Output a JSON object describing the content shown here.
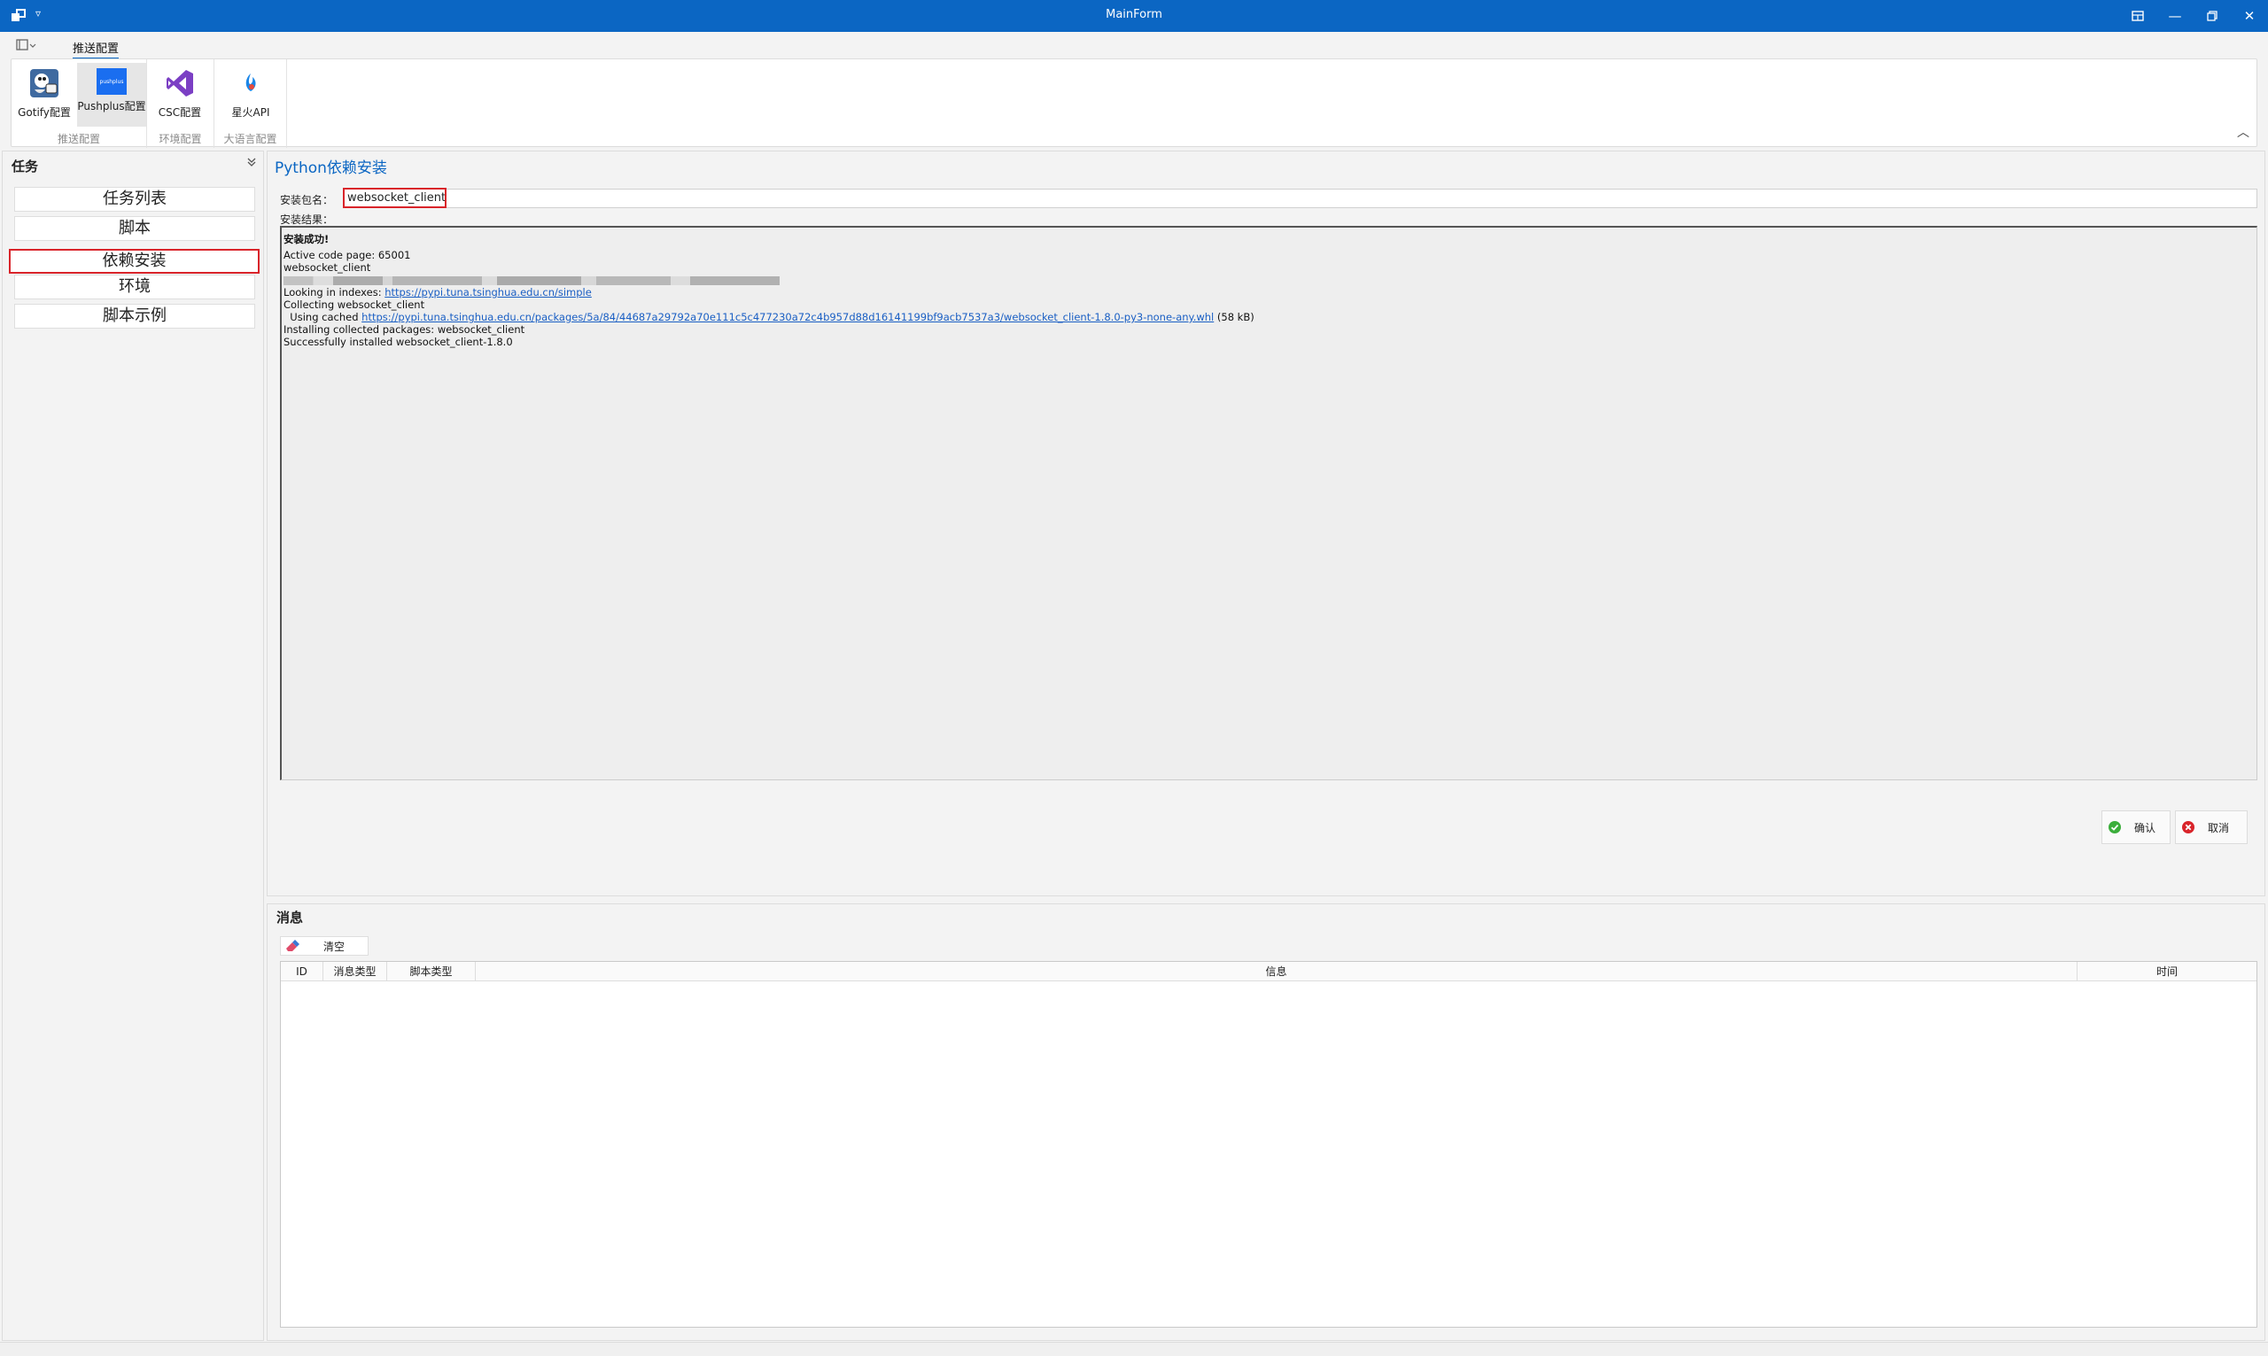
{
  "window": {
    "title": "MainForm"
  },
  "ribbon": {
    "active_tab": "推送配置",
    "groups": [
      {
        "label": "推送配置",
        "buttons": [
          {
            "label": "Gotify配置"
          },
          {
            "label": "Pushplus配置",
            "icon_text": "pushplus"
          }
        ]
      },
      {
        "label": "环境配置",
        "buttons": [
          {
            "label": "CSC配置"
          }
        ]
      },
      {
        "label": "大语言配置",
        "buttons": [
          {
            "label": "星火API"
          }
        ]
      }
    ]
  },
  "left_panel": {
    "title": "任务",
    "items": [
      "任务列表",
      "脚本",
      "依赖安装",
      "环境",
      "脚本示例"
    ],
    "selected_index": 2
  },
  "install": {
    "title": "Python依赖安装",
    "package_label": "安装包名：",
    "package_value": "websocket_client",
    "result_label": "安装结果：",
    "result_lines": {
      "l0": "安装成功!",
      "l1": "Active code page: 65001",
      "l2": "websocket_client",
      "l4_prefix": "Looking in indexes: ",
      "l4_link": "https://pypi.tuna.tsinghua.edu.cn/simple",
      "l5": "Collecting websocket_client",
      "l6_prefix": "  Using cached ",
      "l6_link": "https://pypi.tuna.tsinghua.edu.cn/packages/5a/84/44687a29792a70e111c5c477230a72c4b957d88d16141199bf9acb7537a3/websocket_client-1.8.0-py3-none-any.whl",
      "l6_suffix": " (58 kB)",
      "l7": "Installing collected packages: websocket_client",
      "l8": "Successfully installed websocket_client-1.8.0"
    },
    "confirm_label": "确认",
    "cancel_label": "取消"
  },
  "messages": {
    "title": "消息",
    "clear_label": "清空",
    "columns": [
      "ID",
      "消息类型",
      "脚本类型",
      "信息",
      "时间"
    ]
  },
  "colors": {
    "accent": "#0b66c3",
    "highlight": "#d9242a"
  }
}
